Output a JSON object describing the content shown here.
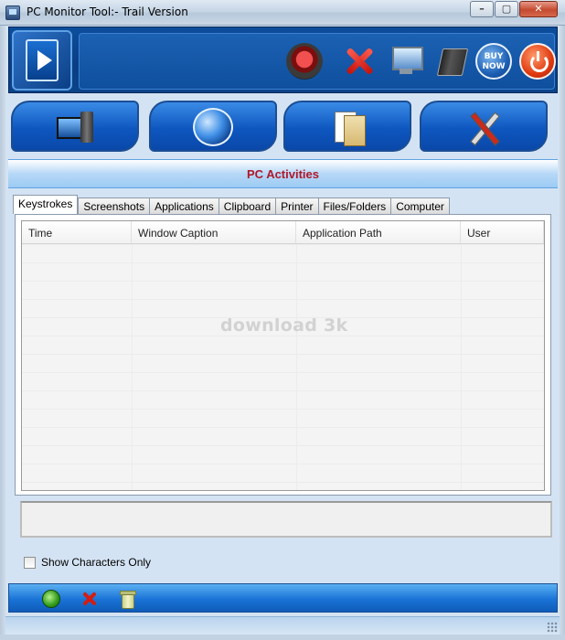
{
  "window": {
    "title": "PC Monitor Tool:- Trail Version",
    "controls": [
      "minimize",
      "maximize",
      "close"
    ]
  },
  "toolbar": {
    "icons": [
      "record-icon",
      "cancel-icon",
      "monitor-icon",
      "book-icon",
      "buy-now-icon",
      "power-icon"
    ],
    "buy_now_label": "BUY NOW"
  },
  "nav_tabs": {
    "icons": [
      "computer-icon",
      "globe-icon",
      "documents-icon",
      "tools-icon"
    ]
  },
  "section": {
    "title": "PC Activities",
    "title_color": "#b0182a"
  },
  "tabs": [
    {
      "label": "Keystrokes",
      "active": true
    },
    {
      "label": "Screenshots"
    },
    {
      "label": "Applications"
    },
    {
      "label": "Clipboard"
    },
    {
      "label": "Printer"
    },
    {
      "label": "Files/Folders"
    },
    {
      "label": "Computer"
    }
  ],
  "grid": {
    "columns": [
      "Time",
      "Window Caption",
      "Application Path",
      "User"
    ],
    "rows": []
  },
  "watermark": "download 3k",
  "options": {
    "show_characters_only_label": "Show Characters Only",
    "show_characters_only_checked": false
  },
  "bottom_actions": {
    "icons": [
      "refresh-icon",
      "delete-icon",
      "clear-log-icon"
    ]
  },
  "colors": {
    "header_blue": "#0a3d82",
    "tab_blue": "#0e57c0",
    "accent_light": "#b7d8f7"
  }
}
